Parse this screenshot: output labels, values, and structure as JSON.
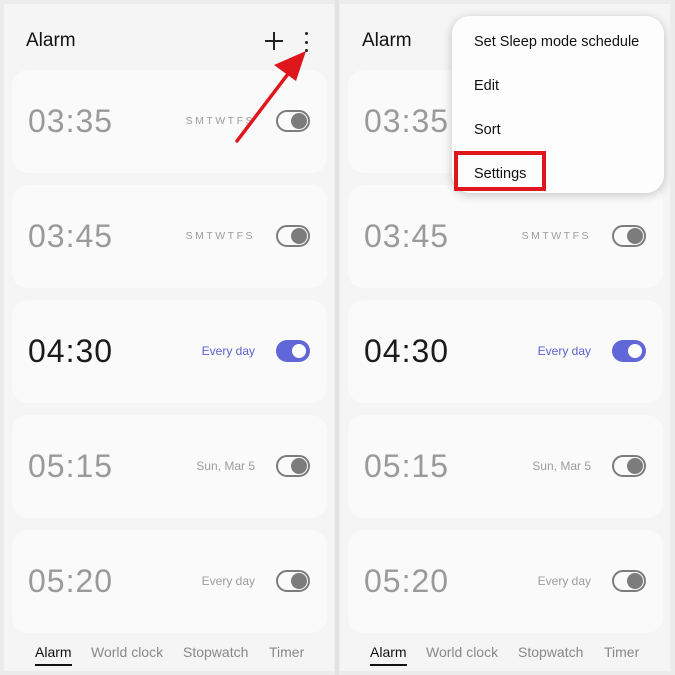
{
  "header": {
    "title": "Alarm"
  },
  "alarms": [
    {
      "time": "03:35",
      "days": "SMTWTFS",
      "label": "",
      "enabled": false
    },
    {
      "time": "03:45",
      "days": "SMTWTFS",
      "label": "",
      "enabled": false
    },
    {
      "time": "04:30",
      "days": "",
      "label": "Every day",
      "enabled": true
    },
    {
      "time": "05:15",
      "days": "",
      "label": "Sun, Mar 5",
      "enabled": false
    },
    {
      "time": "05:20",
      "days": "",
      "label": "Every day",
      "enabled": false
    }
  ],
  "tabs": [
    {
      "label": "Alarm",
      "active": true
    },
    {
      "label": "World clock",
      "active": false
    },
    {
      "label": "Stopwatch",
      "active": false
    },
    {
      "label": "Timer",
      "active": false
    }
  ],
  "overflow_menu": {
    "items": [
      {
        "label": "Set Sleep mode schedule"
      },
      {
        "label": "Edit"
      },
      {
        "label": "Sort"
      },
      {
        "label": "Settings",
        "highlighted": true
      }
    ]
  },
  "icons": {
    "add": "plus-icon",
    "more": "more-options-icon",
    "toggle": "toggle-switch-icon"
  },
  "colors": {
    "accent": "#6267d8",
    "annotation": "#e0161d"
  }
}
